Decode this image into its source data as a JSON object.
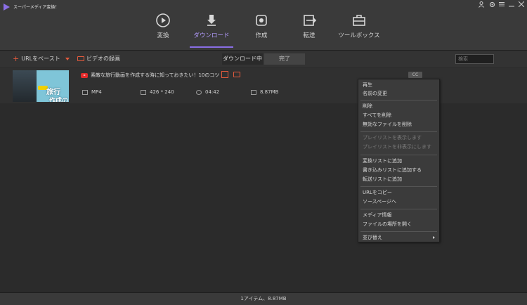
{
  "app": {
    "title": "スーパーメディア変換！"
  },
  "nav": {
    "items": [
      {
        "label": "変換",
        "icon": "play-circle-icon"
      },
      {
        "label": "ダウンロード",
        "icon": "download-icon"
      },
      {
        "label": "作成",
        "icon": "disc-icon"
      },
      {
        "label": "転送",
        "icon": "transfer-icon"
      },
      {
        "label": "ツールボックス",
        "icon": "toolbox-icon"
      }
    ],
    "active": "ダウンロード",
    "accent": "#8a6ee6"
  },
  "toolbar": {
    "paste_url": "URLをペースト",
    "record_video": "ビデオの録画",
    "tab_downloading": "ダウンロード中",
    "tab_done": "完了",
    "search_placeholder": "検索"
  },
  "item": {
    "title": "素敵な旅行動画を作成する時に知っておきたい！10のコツ",
    "format": "MP4",
    "resolution": "426 * 240",
    "duration": "04:42",
    "size": "8.87MB",
    "badge": "CC",
    "thumb_text1": "旅行",
    "thumb_text2": "作成の"
  },
  "context_menu": {
    "groups": [
      [
        {
          "label": "再生"
        },
        {
          "label": "名前の変更"
        }
      ],
      [
        {
          "label": "削除"
        },
        {
          "label": "すべてを削除"
        },
        {
          "label": "無効なファイルを削除"
        }
      ],
      [
        {
          "label": "プレイリストを表示します",
          "disabled": true
        },
        {
          "label": "プレイリストを非表示にします",
          "disabled": true
        }
      ],
      [
        {
          "label": "変換リストに追加"
        },
        {
          "label": "書き込みリストに追加する"
        },
        {
          "label": "転送リストに追加"
        }
      ],
      [
        {
          "label": "URLをコピー"
        },
        {
          "label": "ソースページへ"
        }
      ],
      [
        {
          "label": "メディア情報"
        },
        {
          "label": "ファイルの場所を開く"
        }
      ],
      [
        {
          "label": "並び替え",
          "submenu": true
        }
      ]
    ]
  },
  "status": {
    "text": "1アイテム、8.87MB"
  }
}
